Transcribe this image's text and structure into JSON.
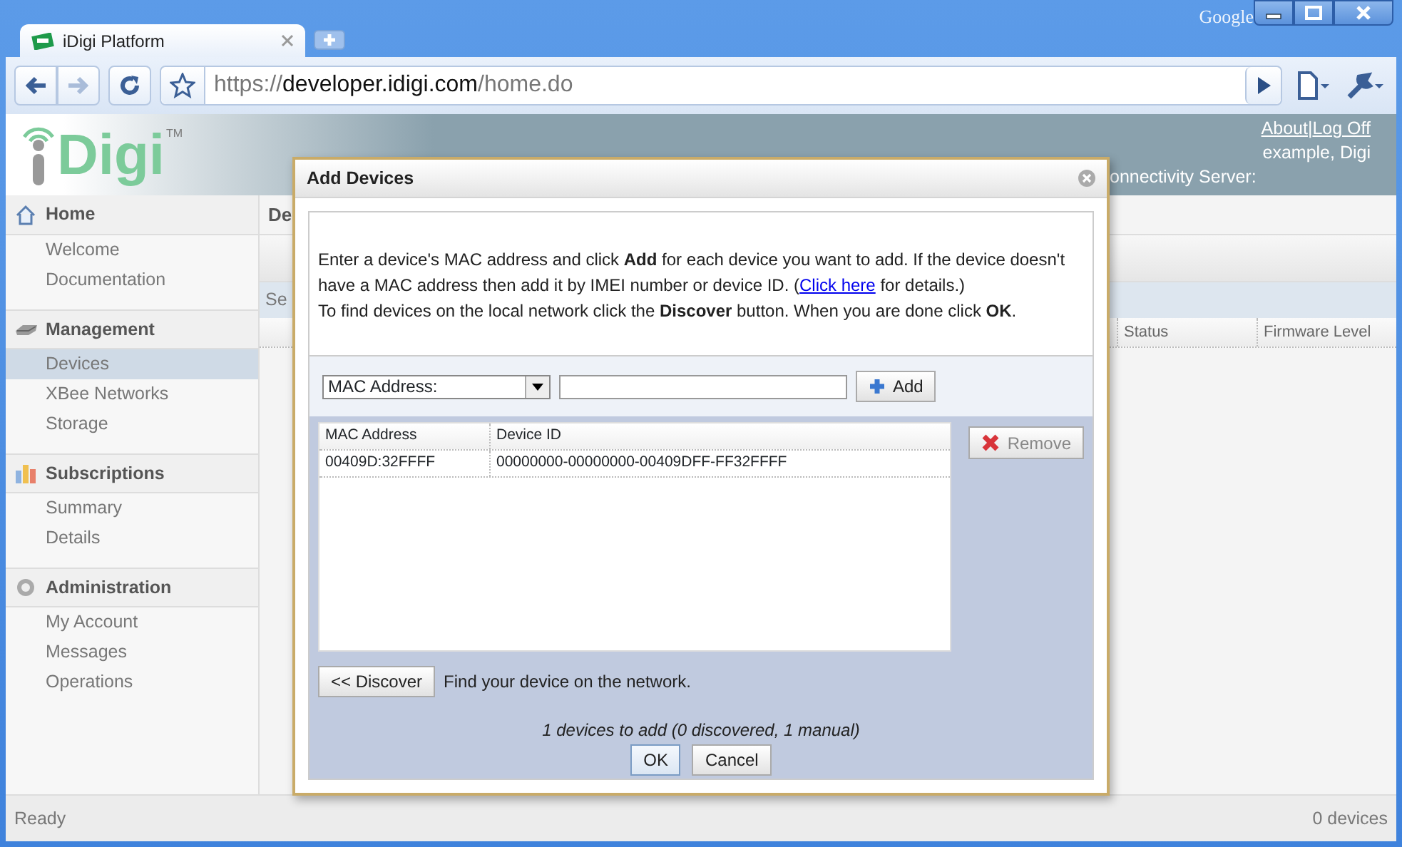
{
  "window": {
    "brand": "Google"
  },
  "tabs": [
    {
      "label": "iDigi Platform",
      "selected": true
    }
  ],
  "url": {
    "scheme": "https://",
    "host": "developer.idigi.com",
    "path": "/home.do"
  },
  "header": {
    "logo": {
      "text": "Digi",
      "mark": "TM"
    },
    "links": [
      "About",
      "Log Off"
    ],
    "separator": "|",
    "user": "example, Digi",
    "server_label": "onnectivity Server:"
  },
  "sidebar": [
    {
      "title": "Home",
      "kind": "house",
      "items": [
        {
          "label": "Welcome",
          "selected": false
        },
        {
          "label": "Documentation",
          "selected": false
        }
      ]
    },
    {
      "title": "Management",
      "kind": "drive",
      "items": [
        {
          "label": "Devices",
          "selected": true
        },
        {
          "label": "XBee Networks",
          "selected": false
        },
        {
          "label": "Storage",
          "selected": false
        }
      ]
    },
    {
      "title": "Subscriptions",
      "kind": "chart",
      "items": [
        {
          "label": "Summary",
          "selected": false
        },
        {
          "label": "Details",
          "selected": false
        }
      ]
    },
    {
      "title": "Administration",
      "kind": "gear",
      "items": [
        {
          "label": "My Account",
          "selected": false
        },
        {
          "label": "Messages",
          "selected": false
        },
        {
          "label": "Operations",
          "selected": false
        }
      ]
    }
  ],
  "main": {
    "breadcrumb": "De",
    "search_label": "Se",
    "columns": [
      "Status",
      "Firmware Level"
    ]
  },
  "dialog": {
    "title": "Add Devices",
    "instructions": {
      "before": "Enter a device's MAC address and click **Add** for each device you want to add. If the device doesn't have a MAC address then add it by IMEI number or device ID. (",
      "link": "Click here",
      "after": " for details.)",
      "second": "To find devices on the local network click the **Discover** button. When you are done click **OK**."
    },
    "id_type": "MAC Address:",
    "add_button": "Add",
    "table": {
      "columns": [
        "MAC Address",
        "Device ID"
      ],
      "rows": [
        [
          "00409D:32FFFF",
          "00000000-00000000-00409DFF-FF32FFFF"
        ]
      ]
    },
    "remove_button": {
      "label": "Remove",
      "disabled": true
    },
    "discover_button": "<< Discover",
    "discover_hint": "Find your device on the network.",
    "summary": "1 devices to add (0 discovered, 1 manual)",
    "buttons": [
      {
        "label": "OK",
        "default": true
      },
      {
        "label": "Cancel",
        "default": false
      }
    ]
  },
  "status_bar": {
    "left": "Ready",
    "right": "0 devices"
  }
}
